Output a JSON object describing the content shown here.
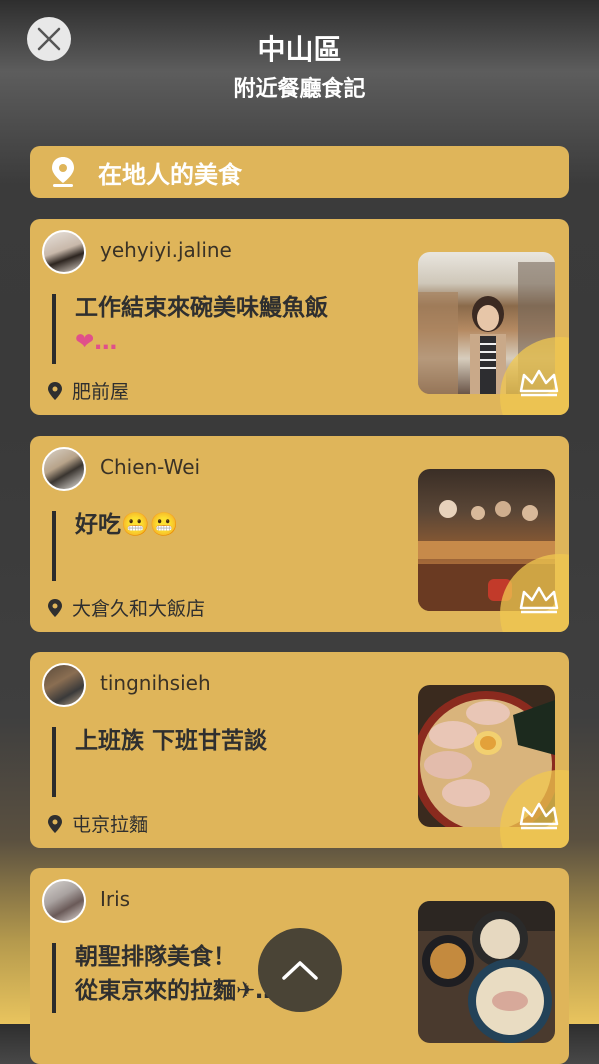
{
  "header": {
    "title": "中山區",
    "subtitle": "附近餐廳食記"
  },
  "section": {
    "label": "在地人的美食"
  },
  "posts": [
    {
      "user": "yehyiyi.jaline",
      "text": "工作結束來碗美味鰻魚飯",
      "text_emoji": "❤…",
      "place": "肥前屋"
    },
    {
      "user": "Chien-Wei",
      "text": "好吃",
      "text_emoji": "😬😬",
      "place": "大倉久和大飯店"
    },
    {
      "user": "tingnihsieh",
      "text": "上班族 下班甘苦談",
      "text_emoji": "",
      "place": "屯京拉麵"
    },
    {
      "user": "Iris",
      "text": "朝聖排隊美食！",
      "text2": "從東京來的拉麵",
      "text_emoji": "✈…",
      "place": ""
    }
  ],
  "colors": {
    "card": "#dfb55a",
    "text": "#2f2f2f",
    "heart": "#e0508a"
  },
  "icons": {
    "close": "close-icon",
    "pin": "map-pin-icon",
    "crown": "crown-icon",
    "scroll_up": "chevron-up-icon"
  }
}
